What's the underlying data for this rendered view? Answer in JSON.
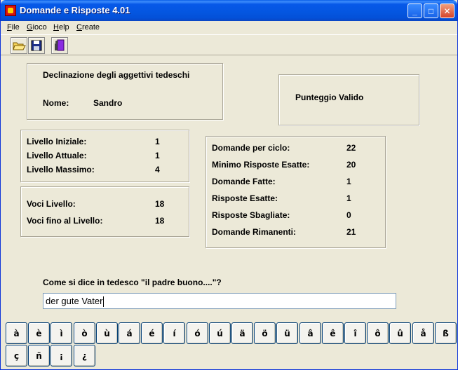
{
  "window": {
    "title": "Domande e Risposte 4.01",
    "controls": [
      "_",
      "□",
      "✕"
    ]
  },
  "menu": [
    {
      "label": "File",
      "underline": "F",
      "rest": "ile"
    },
    {
      "label": "Gioco",
      "underline": "G",
      "rest": "ioco"
    },
    {
      "label": "Help",
      "underline": "H",
      "rest": "elp"
    },
    {
      "label": "Create",
      "underline": "C",
      "rest": "reate"
    }
  ],
  "toolbar": {
    "icons": [
      "open-folder-icon",
      "save-disk-icon",
      "exit-door-icon"
    ]
  },
  "info": {
    "subject": "Declinazione degli aggettivi tedeschi",
    "name_label": "Nome:",
    "name_value": "Sandro"
  },
  "score": {
    "label": "Punteggio Valido"
  },
  "levels": {
    "initial_label": "Livello Iniziale:",
    "initial_value": "1",
    "current_label": "Livello Attuale:",
    "current_value": "1",
    "max_label": "Livello Massimo:",
    "max_value": "4"
  },
  "entries": {
    "level_label": "Voci Livello:",
    "level_value": "18",
    "until_label": "Voci fino al Livello:",
    "until_value": "18"
  },
  "stats": {
    "per_cycle_label": "Domande per ciclo:",
    "per_cycle_value": "22",
    "min_correct_label": "Minimo Risposte Esatte:",
    "min_correct_value": "20",
    "asked_label": "Domande Fatte:",
    "asked_value": "1",
    "correct_label": "Risposte Esatte:",
    "correct_value": "1",
    "wrong_label": "Risposte Sbagliate:",
    "wrong_value": "0",
    "remaining_label": "Domande Rimanenti:",
    "remaining_value": "21"
  },
  "question": {
    "text": "Come si dice in tedesco \"il padre buono....\"?",
    "answer": "der gute Vater"
  },
  "special_keys": [
    "à",
    "è",
    "ì",
    "ò",
    "ù",
    "á",
    "é",
    "í",
    "ó",
    "ú",
    "ä",
    "ö",
    "ü",
    "â",
    "ê",
    "î",
    "ô",
    "û",
    "å",
    "ß",
    "ç",
    "ñ",
    "¡",
    "¿"
  ],
  "colors": {
    "titlebar": "#0458e0",
    "window_bg": "#ece9d8",
    "close_button": "#d6442a"
  }
}
